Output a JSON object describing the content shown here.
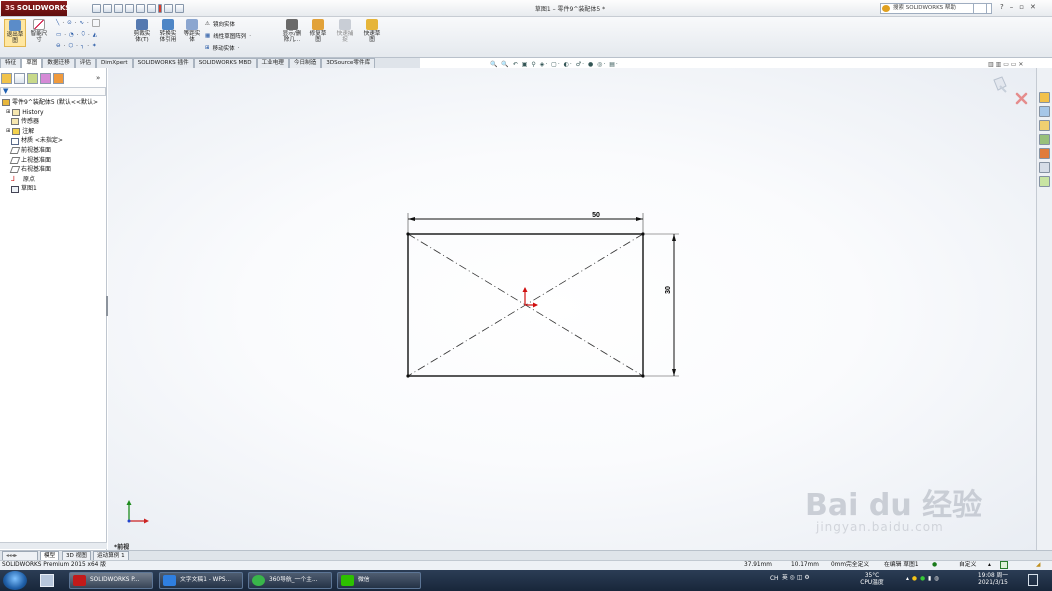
{
  "app": {
    "logo_text": "SOLIDWORKS",
    "logo_prefix": "3S",
    "document_title": "草图1 – 零件9^装配体5 *",
    "search_placeholder": "搜索 SOLIDWORKS 帮助",
    "brand_color": "#7b1414"
  },
  "ribbon": {
    "exit_sketch": "退出草\n图",
    "smart_dimension": "智能尺\n寸",
    "trim_entities": "剪裁实\n体(T)",
    "convert_entities": "转换实\n体引用",
    "offset_entities": "等距实\n体",
    "mirror_entities": "镜向实体",
    "linear_pattern": "线性草图阵列",
    "move_entities": "移动实体",
    "display_delete": "显示/删\n除几...",
    "repair_sketch": "修复草\n图",
    "rapid_snaps": "快速捕\n捉",
    "rapid_sketch": "快速草\n图"
  },
  "tabs": [
    "特征",
    "草图",
    "数据迁移",
    "评估",
    "DimXpert",
    "SOLIDWORKS 插件",
    "SOLIDWORKS MBD",
    "工业电理",
    "今日制造",
    "3DSource零件库"
  ],
  "active_tab": "草图",
  "tree": {
    "root": "零件9^装配体5  (默认<<默认>",
    "items": [
      "History",
      "传感器",
      "注解",
      "材质 <未指定>",
      "前视基准面",
      "上视基准面",
      "右视基准面",
      "原点",
      "草图1"
    ]
  },
  "sketch": {
    "width_dim": "50",
    "height_dim": "30",
    "view_label": "*前视"
  },
  "bottom_tabs": [
    "模型",
    "3D 视图",
    "运动算例 1"
  ],
  "status": {
    "product": "SOLIDWORKS Premium 2015 x64 版",
    "x": "37.91mm",
    "y": "10.17mm",
    "z": "0mm",
    "state": "完全定义",
    "editing": "在编辑 草图1",
    "custom": "自定义"
  },
  "taskbar": {
    "items": [
      "SOLIDWORKS P...",
      "文字文稿1 - WPS...",
      "360导航_一个主...",
      "微信"
    ],
    "temp": "35°C",
    "temp_label": "CPU温度",
    "lang": "CH",
    "time": "19:08 周一",
    "date": "2021/3/15"
  },
  "watermark": {
    "main": "Bai du 经验",
    "sub": "jingyan.baidu.com"
  }
}
